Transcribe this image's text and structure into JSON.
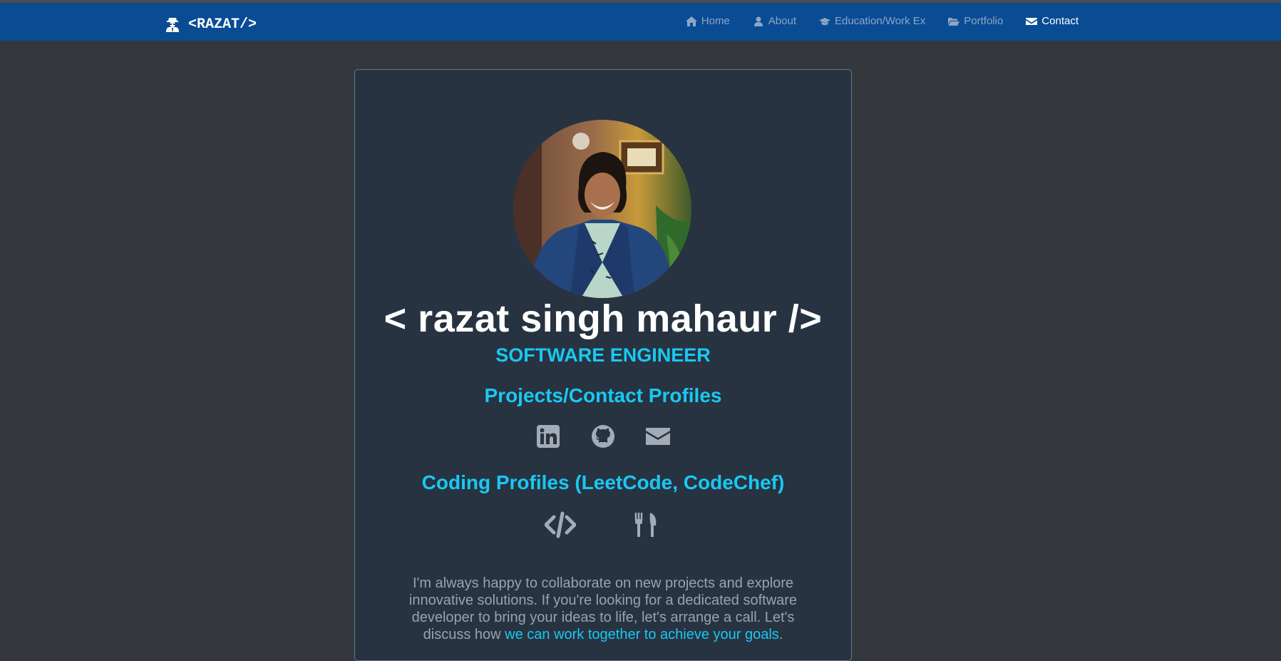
{
  "brand": {
    "label": "<RAZAT/>",
    "icon": "user-secret-icon"
  },
  "nav": {
    "items": [
      {
        "label": "Home",
        "icon": "home-icon",
        "active": false
      },
      {
        "label": "About",
        "icon": "user-icon",
        "active": false
      },
      {
        "label": "Education/Work Ex",
        "icon": "graduation-cap-icon",
        "active": false
      },
      {
        "label": "Portfolio",
        "icon": "folder-open-icon",
        "active": false
      },
      {
        "label": "Contact",
        "icon": "envelope-icon",
        "active": true
      }
    ]
  },
  "profile": {
    "name": "< razat singh mahaur />",
    "role": "SOFTWARE ENGINEER",
    "projects_heading": "Projects/Contact Profiles",
    "projects_icons": [
      "linkedin-icon",
      "github-icon",
      "envelope-icon"
    ],
    "coding_heading": "Coding Profiles (LeetCode, CodeChef)",
    "coding_icons": [
      "code-icon",
      "cutlery-icon"
    ],
    "blurb_text": "I'm always happy to collaborate on new projects and explore innovative solutions. If you're looking for a dedicated software developer to bring your ideas to life, let's arrange a call. Let's discuss how ",
    "blurb_link": "we can work together to achieve your goals",
    "blurb_end": "."
  },
  "colors": {
    "navbar": "#0a4c94",
    "background": "#34373b",
    "card": "#273341",
    "accent": "#19c8f2",
    "icon": "#a3acb6"
  }
}
